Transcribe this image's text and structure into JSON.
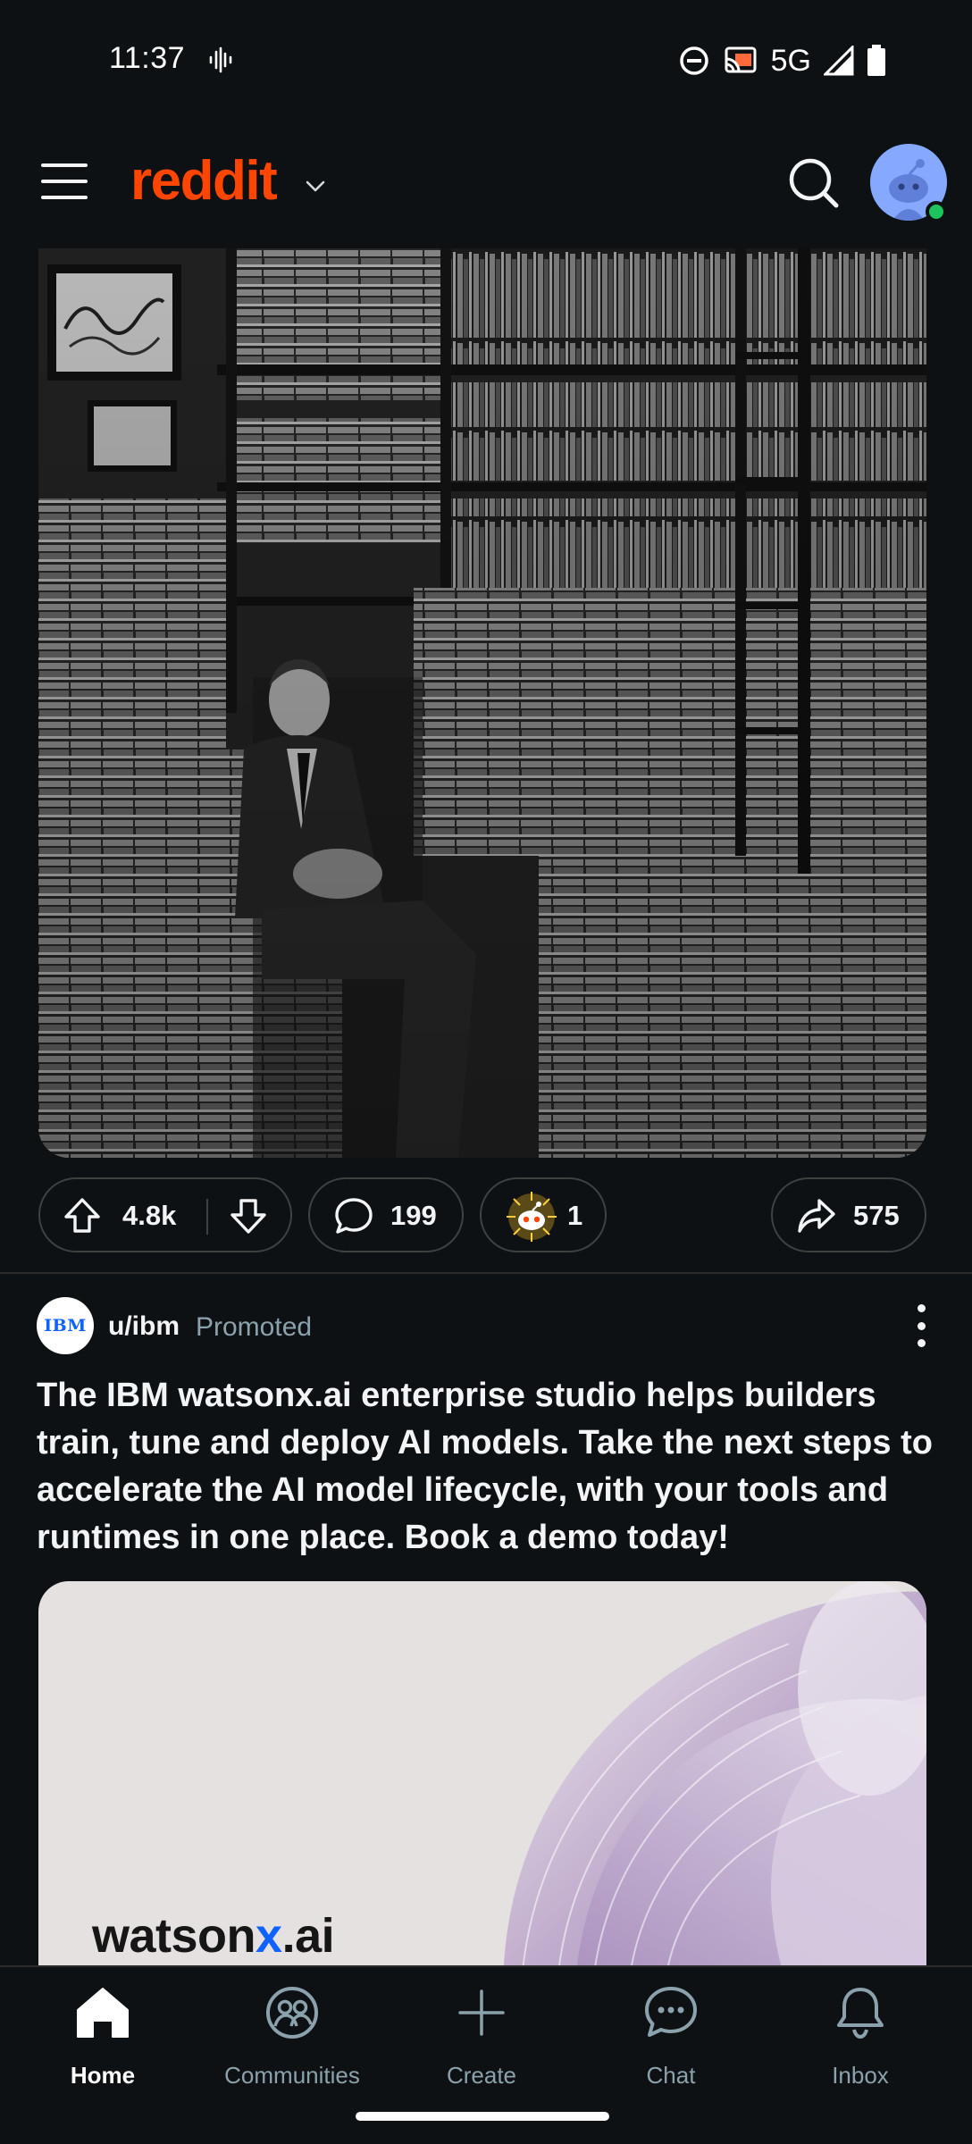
{
  "status_bar": {
    "time": "11:37",
    "network": "5G"
  },
  "header": {
    "logo_text": "reddit"
  },
  "post": {
    "upvotes": "4.8k",
    "comments": "199",
    "awards": "1",
    "shares": "575"
  },
  "ad": {
    "logo_text": "IBM",
    "username": "u/ibm",
    "promoted_label": "Promoted",
    "title": "The IBM watsonx.ai enterprise studio helps builders train, tune and deploy AI models. Take the next steps to accelerate the AI model lifecycle, with your tools and runtimes in one place. Book a demo today!",
    "brand_prefix": "watson",
    "brand_x": "x",
    "brand_suffix": ".ai"
  },
  "bottom_nav": {
    "items": [
      {
        "label": "Home",
        "icon": "home-icon",
        "active": true
      },
      {
        "label": "Communities",
        "icon": "communities-icon",
        "active": false
      },
      {
        "label": "Create",
        "icon": "plus-icon",
        "active": false
      },
      {
        "label": "Chat",
        "icon": "chat-icon",
        "active": false
      },
      {
        "label": "Inbox",
        "icon": "bell-icon",
        "active": false
      }
    ]
  },
  "colors": {
    "background": "#0e1113",
    "brand": "#ff4500",
    "muted_text": "#8ba2ad",
    "ibm_blue": "#0f62fe",
    "online": "#1ec45d"
  }
}
